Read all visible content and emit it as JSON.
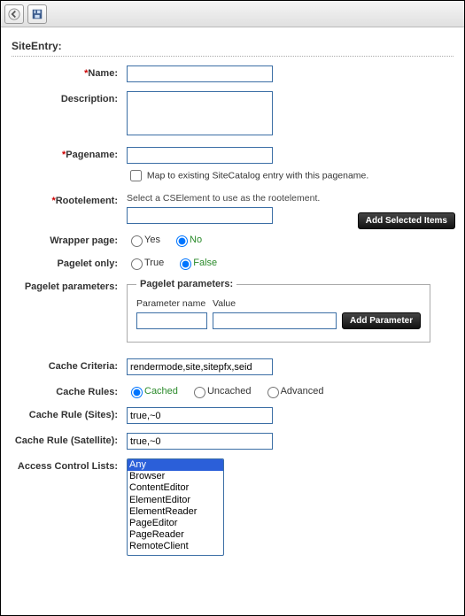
{
  "title": "SiteEntry:",
  "toolbar": {
    "back": "Back",
    "save": "Save"
  },
  "labels": {
    "name": "Name:",
    "description": "Description:",
    "pagename": "Pagename:",
    "rootelement": "Rootelement:",
    "wrapper": "Wrapper page:",
    "pagelet_only": "Pagelet only:",
    "pagelet_params": "Pagelet parameters:",
    "cache_criteria": "Cache Criteria:",
    "cache_rules": "Cache Rules:",
    "cache_rule_sites": "Cache Rule (Sites):",
    "cache_rule_satellite": "Cache Rule (Satellite):",
    "acl": "Access Control Lists:"
  },
  "fields": {
    "name": "",
    "description": "",
    "pagename": "",
    "map_checkbox_label": "Map to existing SiteCatalog entry with this pagename.",
    "map_checked": false,
    "rootelement_hint": "Select a CSElement to use as the rootelement.",
    "rootelement": "",
    "add_selected_label": "Add Selected Items",
    "wrapper_options": [
      "Yes",
      "No"
    ],
    "wrapper_selected": "No",
    "pagelet_only_options": [
      "True",
      "False"
    ],
    "pagelet_only_selected": "False",
    "pagelet_legend": "Pagelet parameters:",
    "param_name_header": "Parameter name",
    "param_value_header": "Value",
    "param_name": "",
    "param_value": "",
    "add_param_label": "Add Parameter",
    "cache_criteria": "rendermode,site,sitepfx,seid",
    "cache_rules_options": [
      "Cached",
      "Uncached",
      "Advanced"
    ],
    "cache_rules_selected": "Cached",
    "cache_rule_sites": "true,~0",
    "cache_rule_satellite": "true,~0",
    "acl_options": [
      "Any",
      "Browser",
      "ContentEditor",
      "ElementEditor",
      "ElementReader",
      "PageEditor",
      "PageReader",
      "RemoteClient"
    ],
    "acl_selected": "Any"
  }
}
